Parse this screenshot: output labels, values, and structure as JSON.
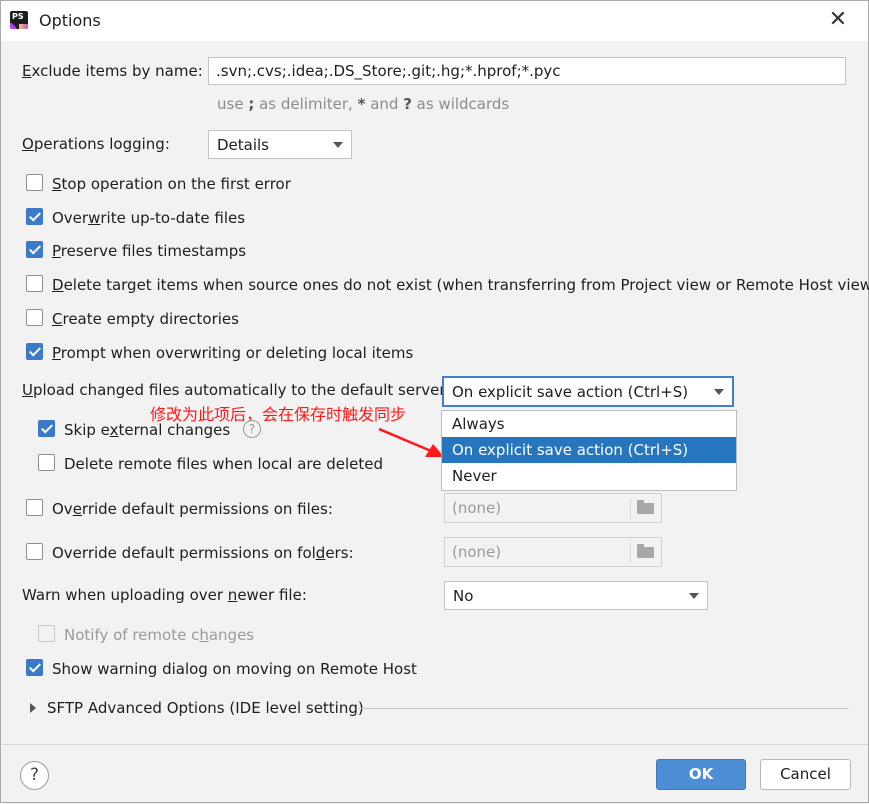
{
  "window": {
    "title": "Options",
    "close_glyph": "✕",
    "app_icon": "PS"
  },
  "exclude": {
    "label_prefix": "",
    "label_mnemonic": "E",
    "label_rest": "xclude items by name:",
    "value": ".svn;.cvs;.idea;.DS_Store;.git;.hg;*.hprof;*.pyc",
    "hint_use": "use ",
    "hint_semicolon": ";",
    "hint_mid": " as delimiter, ",
    "hint_star": "*",
    "hint_and": " and ",
    "hint_q": "?",
    "hint_end": " as wildcards"
  },
  "ops_logging": {
    "label_mnemonic": "O",
    "label_rest": "perations logging:",
    "value": "Details"
  },
  "checkboxes": [
    {
      "pre": "",
      "mn": "S",
      "post": "top operation on the first error",
      "checked": false
    },
    {
      "pre": "Over",
      "mn": "w",
      "post": "rite up-to-date files",
      "checked": true
    },
    {
      "pre": "",
      "mn": "P",
      "post": "reserve files timestamps",
      "checked": true
    },
    {
      "pre": "",
      "mn": "D",
      "post": "elete target items when source ones do not exist (when transferring from Project view or Remote Host view)",
      "checked": false
    },
    {
      "pre": "",
      "mn": "C",
      "post": "reate empty directories",
      "checked": false
    },
    {
      "pre": "",
      "mn": "P",
      "post": "rompt when overwriting or deleting local items",
      "checked": true
    }
  ],
  "upload": {
    "label_mnemonic": "U",
    "label_rest": "pload changed files automatically to the default server",
    "value": "On explicit save action (Ctrl+S)",
    "options": [
      "Always",
      "On explicit save action (Ctrl+S)",
      "Never"
    ],
    "selected_index": 1
  },
  "annotation": {
    "text": "修改为此项后，会在保存时触发同步",
    "color": "#ff1a1a"
  },
  "skip_external": {
    "pre": "Skip e",
    "mn": "x",
    "post": "ternal changes",
    "checked": true,
    "help_glyph": "?"
  },
  "delete_remote": {
    "label": "Delete remote files when local are deleted",
    "checked": false
  },
  "override_files": {
    "pre": "Ov",
    "mn": "e",
    "post": "rride default permissions on files:",
    "value": "(none)",
    "checked": false
  },
  "override_folders": {
    "pre": "Override default permissions on fol",
    "mn": "d",
    "post": "ers:",
    "value": "(none)",
    "checked": false
  },
  "warn_newer": {
    "pre": "Warn when uploading over ",
    "mn": "n",
    "post": "ewer file:",
    "value": "No"
  },
  "notify_remote": {
    "pre": "Notify of remote c",
    "mn": "h",
    "post": "anges",
    "checked": false,
    "disabled": true
  },
  "show_warning": {
    "label": "Show warning dialog on moving on Remote Host",
    "checked": true
  },
  "sftp": {
    "label": "SFTP Advanced Options (IDE level setting)"
  },
  "footer": {
    "help_glyph": "?",
    "ok_label": "OK",
    "cancel_label": "Cancel"
  },
  "colors": {
    "accent": "#2675bf",
    "ok_button": "#4c8fd6",
    "checkbox_checked": "#3c7ac9"
  }
}
